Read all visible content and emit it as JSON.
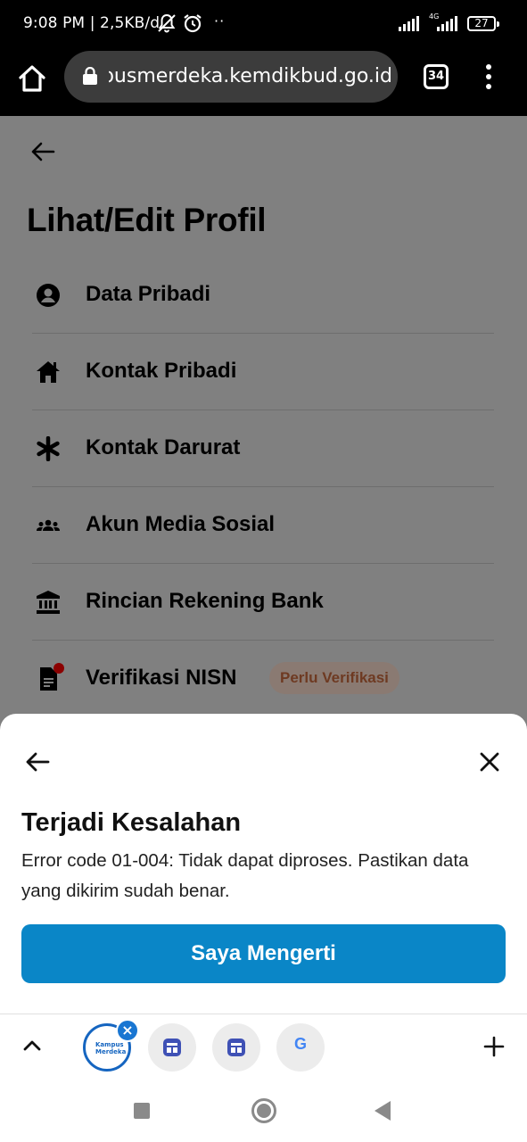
{
  "status_bar": {
    "time": "9:08 PM | 2,5KB/d",
    "network_type": "4G",
    "battery": "27",
    "more_indicator": "··"
  },
  "browser": {
    "url": "kampusmerdeka.kemdikbud.go.id",
    "tab_count": "34"
  },
  "page": {
    "title": "Lihat/Edit Profil",
    "menu": [
      {
        "label": "Data Pribadi",
        "icon": "account-circle-icon"
      },
      {
        "label": "Kontak Pribadi",
        "icon": "house-icon"
      },
      {
        "label": "Kontak Darurat",
        "icon": "asterisk-icon"
      },
      {
        "label": "Akun Media Sosial",
        "icon": "people-icon"
      },
      {
        "label": "Rincian Rekening Bank",
        "icon": "bank-icon"
      },
      {
        "label": "Verifikasi NISN",
        "icon": "document-icon",
        "badge": "Perlu Verifikasi"
      }
    ]
  },
  "dialog": {
    "title": "Terjadi Kesalahan",
    "message": "Error code 01-004: Tidak dapat diproses. Pastikan data yang dikirim sudah benar.",
    "button_label": "Saya Mengerti"
  },
  "tab_strip": {
    "active_tab_logo_line1": "Kampus",
    "active_tab_logo_line2": "Merdeka",
    "google_letter": "G"
  },
  "colors": {
    "primary_button": "#0a86c7",
    "badge_text": "#6e3a22",
    "overlay": "#808080"
  }
}
